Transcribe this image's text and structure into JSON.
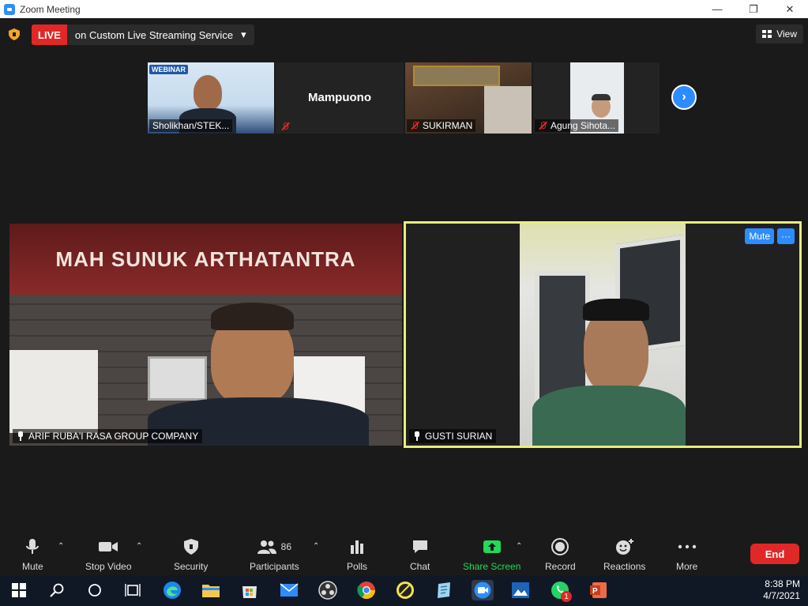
{
  "window": {
    "title": "Zoom Meeting",
    "minimize": "—",
    "maximize": "❐",
    "close": "✕"
  },
  "live": {
    "badge": "LIVE",
    "text": "on Custom Live Streaming Service",
    "caret": "▾"
  },
  "view": {
    "label": "View"
  },
  "thumbnails": [
    {
      "name": "Sholikhan/STEK...",
      "muted": false
    },
    {
      "name": "Mampuono",
      "muted": true
    },
    {
      "name": "SUKIRMAN",
      "muted": true
    },
    {
      "name": "Agung Sihota...",
      "muted": true
    }
  ],
  "webinar_banner": "WEBINAR",
  "video_tiles": [
    {
      "name": "ARIF RUBA'I RASA GROUP COMPANY",
      "sign_text": "MAH SUNUK ARTHATANTRA"
    },
    {
      "name": "GUSTI SURIAN",
      "mute_label": "Mute",
      "more_label": "···"
    }
  ],
  "toolbar": {
    "mute": "Mute",
    "stop_video": "Stop Video",
    "security": "Security",
    "participants": "Participants",
    "participants_count": "86",
    "polls": "Polls",
    "chat": "Chat",
    "share_screen": "Share Screen",
    "record": "Record",
    "reactions": "Reactions",
    "more": "More",
    "end": "End"
  },
  "taskbar": {
    "time": "8:38 PM",
    "date": "4/7/2021",
    "whatsapp_badge": "1"
  },
  "colors": {
    "accent": "#2d8cff",
    "live_red": "#e02828",
    "share_green": "#23d959",
    "active_border": "#e7ee7a"
  }
}
